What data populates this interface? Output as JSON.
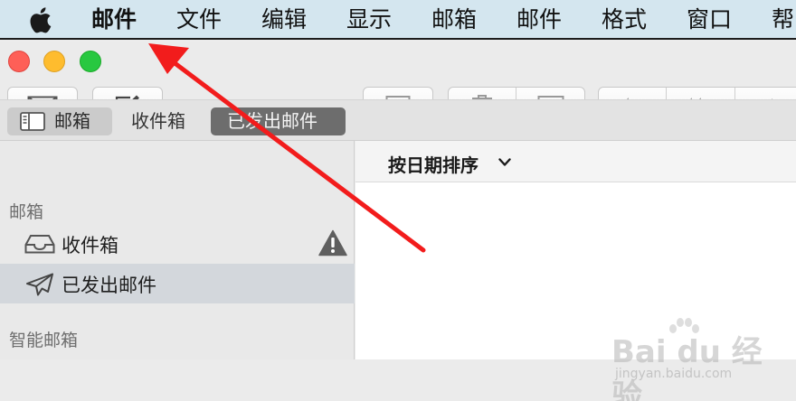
{
  "menubar": {
    "app_name": "邮件",
    "items": [
      "文件",
      "编辑",
      "显示",
      "邮箱",
      "邮件",
      "格式",
      "窗口",
      "帮"
    ]
  },
  "favorites": {
    "mailboxes_label": "邮箱",
    "inbox_label": "收件箱",
    "sent_label": "已发出邮件"
  },
  "sidebar": {
    "section_mailboxes": "邮箱",
    "inbox": "收件箱",
    "sent": "已发出邮件",
    "section_smart": "智能邮箱"
  },
  "list": {
    "sort_label": "按日期排序"
  },
  "watermark": {
    "brand": "Bai du 经验",
    "url": "jingyan.baidu.com"
  },
  "colors": {
    "annotation_arrow": "#f21c1c",
    "menubar_bg": "#d4e6ef",
    "close": "#fe5f57",
    "minimize": "#febc2e",
    "zoom": "#28c840"
  }
}
